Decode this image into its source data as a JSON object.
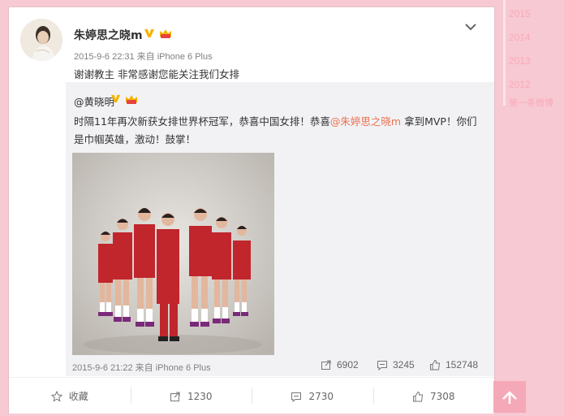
{
  "timeline": {
    "years": [
      "2015",
      "2014",
      "2013",
      "2012"
    ],
    "first_post": "第一条微博"
  },
  "post": {
    "author": "朱婷思之晓m",
    "meta": "2015-9-6 22:31 来自 iPhone 6 Plus",
    "text": "谢谢教主 非常感谢您能关注我们女排",
    "more_icon": "chevron-down-icon"
  },
  "repost": {
    "author": "@黄晓明",
    "text_before": "时隔11年再次新获女排世界杯冠军，恭喜中国女排！恭喜",
    "mention": "@朱婷思之晓m",
    "text_after": " 拿到MVP！你们是巾帼英雄，激动！鼓掌！",
    "meta": "2015-9-6 21:22 来自 iPhone 6 Plus",
    "reposts": "6902",
    "comments": "3245",
    "likes": "152748"
  },
  "actions": {
    "favorite": "收藏",
    "repost": "1230",
    "comment": "2730",
    "like": "7308"
  },
  "colors": {
    "page_bg": "#f7c9d2",
    "link": "#eb7350",
    "v_badge": "#f5b400"
  }
}
